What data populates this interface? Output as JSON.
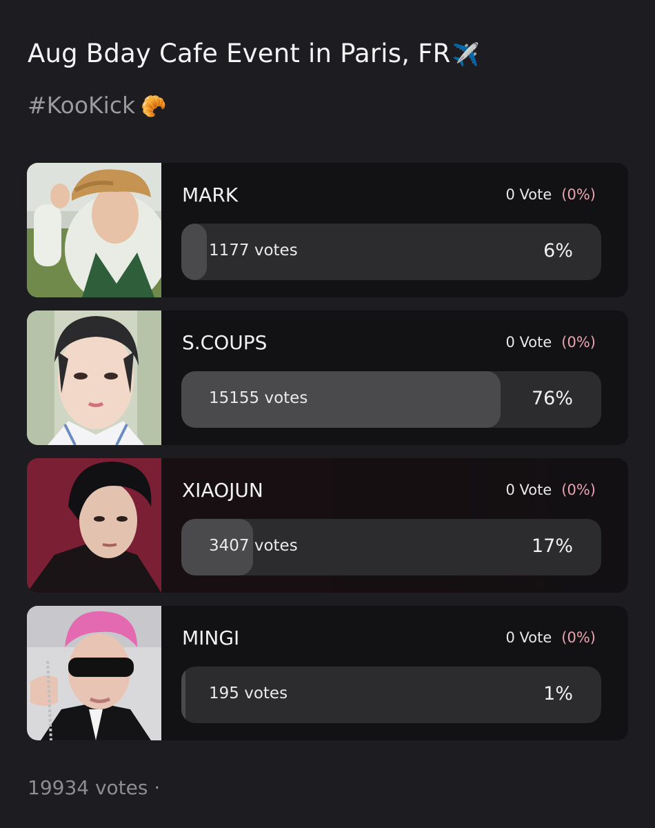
{
  "poll": {
    "title": "Aug Bday Cafe Event in Paris, FR",
    "title_emoji": "✈️",
    "hashtag": "#KooKick",
    "hashtag_emoji": "🥐",
    "options": [
      {
        "name": "MARK",
        "vote_label": "0 Vote",
        "vote_pct_label": "(0%)",
        "votes_label": "1177 votes",
        "percent_label": "6%",
        "fraction": 0.06
      },
      {
        "name": "S.COUPS",
        "vote_label": "0 Vote",
        "vote_pct_label": "(0%)",
        "votes_label": "15155 votes",
        "percent_label": "76%",
        "fraction": 0.76
      },
      {
        "name": "XIAOJUN",
        "vote_label": "0 Vote",
        "vote_pct_label": "(0%)",
        "votes_label": "3407 votes",
        "percent_label": "17%",
        "fraction": 0.17
      },
      {
        "name": "MINGI",
        "vote_label": "0 Vote",
        "vote_pct_label": "(0%)",
        "votes_label": "195 votes",
        "percent_label": "1%",
        "fraction": 0.01
      }
    ],
    "total_label": "19934 votes ·"
  },
  "colors": {
    "background": "#1c1c21",
    "card": "#121214",
    "bar_track": "#2c2c2f",
    "bar_fill": "#4a4a4d",
    "pct_accent": "#e9a3b2"
  }
}
